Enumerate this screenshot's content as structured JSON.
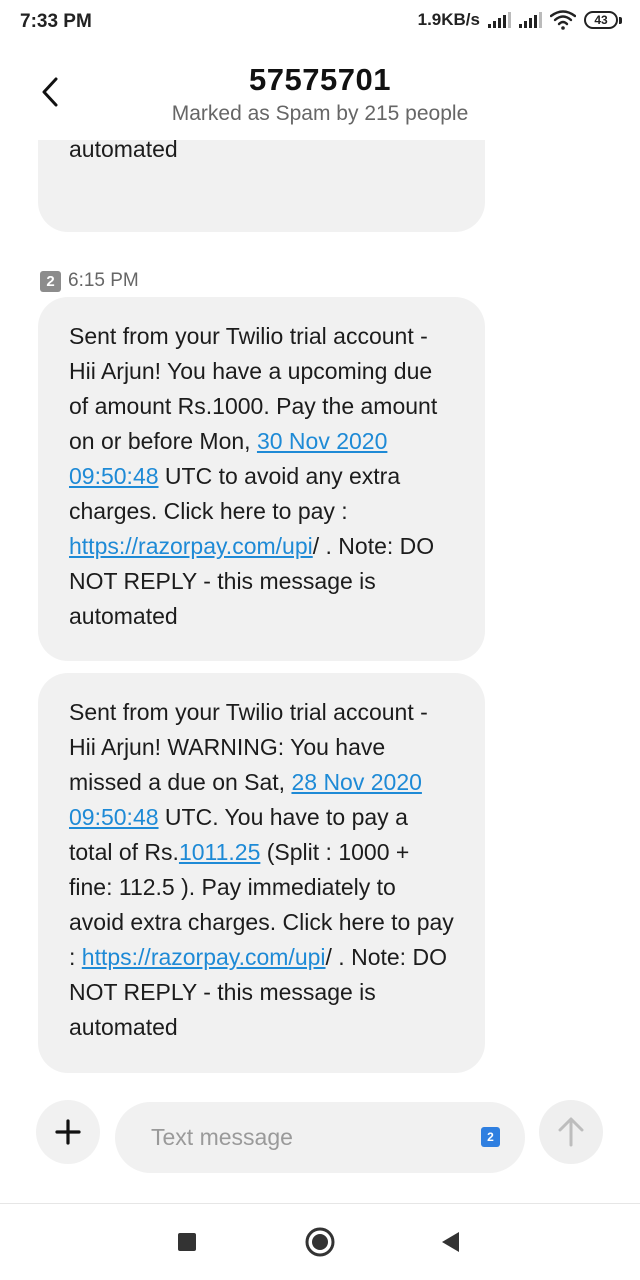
{
  "status_bar": {
    "time": "7:33 PM",
    "net_speed": "1.9KB/s",
    "battery": "43",
    "icons": [
      "signal-icon",
      "signal-icon",
      "wifi-icon",
      "battery-icon"
    ]
  },
  "header": {
    "title": "57575701",
    "subtitle": "Marked as Spam by 215 people",
    "back_icon": "chevron-left-icon"
  },
  "messages": {
    "partial": {
      "text": "DO NOT REPLY - this message is automated"
    },
    "meta": {
      "sim": "2",
      "time": "6:15 PM"
    },
    "msg1": {
      "t1": "Sent from your Twilio trial account - Hii Arjun! You have a upcoming due of amount Rs.1000. Pay the amount on or before Mon, ",
      "l1": "30 Nov 2020 09:50:48",
      "t2": " UTC to avoid any extra charges. Click here to pay : ",
      "l2": "https://razorpay.com/upi",
      "t3": "/ . Note: DO NOT REPLY - this message is automated"
    },
    "msg2": {
      "t1": "Sent from your Twilio trial account - Hii Arjun! WARNING: You have missed a due on Sat, ",
      "l1": "28 Nov 2020 09:50:48",
      "t2": " UTC. You have to pay a total of Rs.",
      "l2": "1011.25",
      "t3": " (Split : 1000 + fine: 112.5 ). Pay immediately to avoid extra charges. Click here to pay : ",
      "l3": "https://razorpay.com/upi",
      "t4": "/ . Note: DO NOT REPLY - this message is automated"
    }
  },
  "composer": {
    "placeholder": "Text message",
    "sim_indicator": "2",
    "add_icon": "plus-icon",
    "send_icon": "arrow-up-icon"
  },
  "nav_bar": {
    "icons": [
      "square-icon",
      "circle-icon",
      "triangle-back-icon"
    ]
  }
}
